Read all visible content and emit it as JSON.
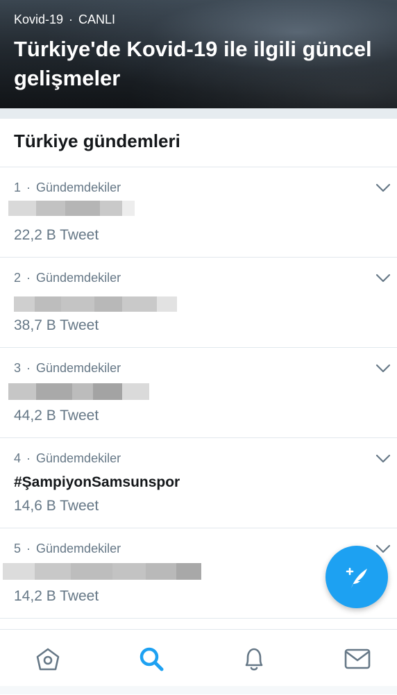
{
  "hero": {
    "category": "Kovid-19",
    "separator": "·",
    "status": "CANLI",
    "title": "Türkiye'de Kovid-19 ile ilgili güncel gelişmeler"
  },
  "section": {
    "title": "Türkiye gündemleri"
  },
  "trends": [
    {
      "rank": "1",
      "sep": "·",
      "context": "Gündemdekiler",
      "name": "",
      "count": "22,2 B Tweet"
    },
    {
      "rank": "2",
      "sep": "·",
      "context": "Gündemdekiler",
      "name": "",
      "count": "38,7 B Tweet"
    },
    {
      "rank": "3",
      "sep": "·",
      "context": "Gündemdekiler",
      "name": "",
      "count": "44,2 B Tweet"
    },
    {
      "rank": "4",
      "sep": "·",
      "context": "Gündemdekiler",
      "name": "#ŞampiyonSamsunspor",
      "count": "14,6 B Tweet"
    },
    {
      "rank": "5",
      "sep": "·",
      "context": "Gündemdekiler",
      "name": "",
      "count": "14,2 B Tweet"
    }
  ],
  "icons": {
    "trend_menu": "chevron-down-icon",
    "fab": "compose-tweet-icon",
    "nav": [
      "home-icon",
      "search-icon",
      "notifications-icon",
      "messages-icon"
    ]
  },
  "colors": {
    "accent": "#1da1f2",
    "secondary_text": "#657786",
    "divider": "#e1e8ed"
  }
}
